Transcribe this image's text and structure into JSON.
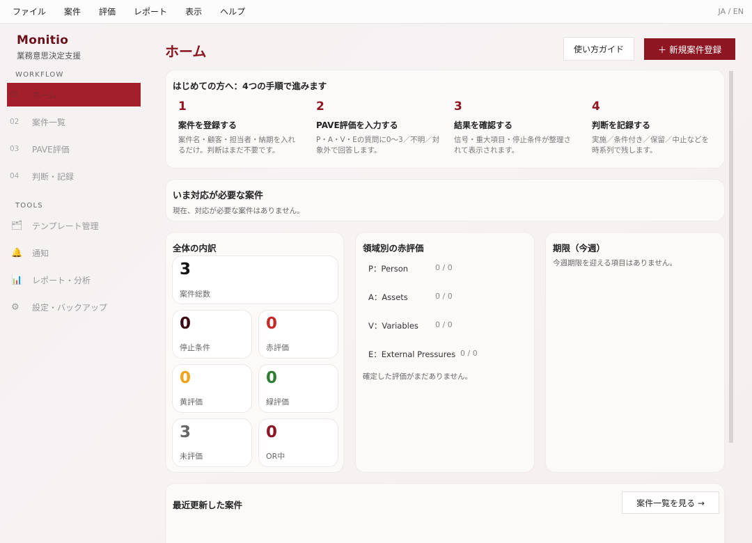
{
  "menubar": {
    "items": [
      "ファイル",
      "案件",
      "評価",
      "レポート",
      "表示",
      "ヘルプ"
    ],
    "lang": "JA / EN"
  },
  "sidebar": {
    "brand": "Monitio",
    "brand_sub": "業務意思決定支援",
    "workflow_title": "WORKFLOW",
    "workflow": [
      {
        "num": "01",
        "label": "ホーム"
      },
      {
        "num": "02",
        "label": "案件一覧"
      },
      {
        "num": "03",
        "label": "PAVE評価"
      },
      {
        "num": "04",
        "label": "判断・記録"
      }
    ],
    "tools_title": "TOOLS",
    "tools": [
      {
        "icon": "folder-icon",
        "glyph": "🗂",
        "label": "テンプレート管理"
      },
      {
        "icon": "bell-icon",
        "glyph": "🔔",
        "label": "通知"
      },
      {
        "icon": "chart-icon",
        "glyph": "📊",
        "label": "レポート・分析"
      },
      {
        "icon": "gear-icon",
        "glyph": "⚙",
        "label": "設定・バックアップ"
      }
    ]
  },
  "header": {
    "title": "ホーム",
    "guide_button": "使い方ガイド",
    "new_button": "＋ 新規案件登録"
  },
  "intro": {
    "title": "はじめての方へ：4つの手順で進みます",
    "steps": [
      {
        "num": "1",
        "title": "案件を登録する",
        "desc": "案件名・顧客・担当者・納期を入れるだけ。判断はまだ不要です。"
      },
      {
        "num": "2",
        "title": "PAVE評価を入力する",
        "desc": "P・A・V・Eの質問に0〜3／不明／対象外で回答します。"
      },
      {
        "num": "3",
        "title": "結果を確認する",
        "desc": "信号・重大項目・停止条件が整理されて表示されます。"
      },
      {
        "num": "4",
        "title": "判断を記録する",
        "desc": "実施／条件付き／保留／中止などを時系列で残します。"
      }
    ]
  },
  "action_needed": {
    "title": "いま対応が必要な案件",
    "empty": "現在、対応が必要な案件はありません。"
  },
  "breakdown": {
    "title": "全体の内訳",
    "total": {
      "value": "3",
      "label": "案件総数"
    },
    "stats": [
      {
        "value": "0",
        "label": "停止条件",
        "color": "#3a0b10"
      },
      {
        "value": "0",
        "label": "赤評価",
        "color": "#c62828"
      },
      {
        "value": "0",
        "label": "黄評価",
        "color": "#f0a31a"
      },
      {
        "value": "0",
        "label": "緑評価",
        "color": "#2e7d32"
      },
      {
        "value": "3",
        "label": "未評価",
        "color": "#666666"
      },
      {
        "value": "0",
        "label": "OR中",
        "color": "#8e1522"
      }
    ]
  },
  "domains": {
    "title": "領域別の赤評価",
    "rows": [
      {
        "label": "P：Person",
        "count": "0 / 0"
      },
      {
        "label": "A：Assets",
        "count": "0 / 0"
      },
      {
        "label": "V：Variables",
        "count": "0 / 0"
      },
      {
        "label": "E：External Pressures",
        "count": "0 / 0"
      }
    ],
    "empty": "確定した評価がまだありません。"
  },
  "deadline": {
    "title": "期限（今週）",
    "empty": "今週期限を迎える項目はありません。"
  },
  "recent": {
    "title": "最近更新した案件",
    "list_button": "案件一覧を見る →"
  }
}
